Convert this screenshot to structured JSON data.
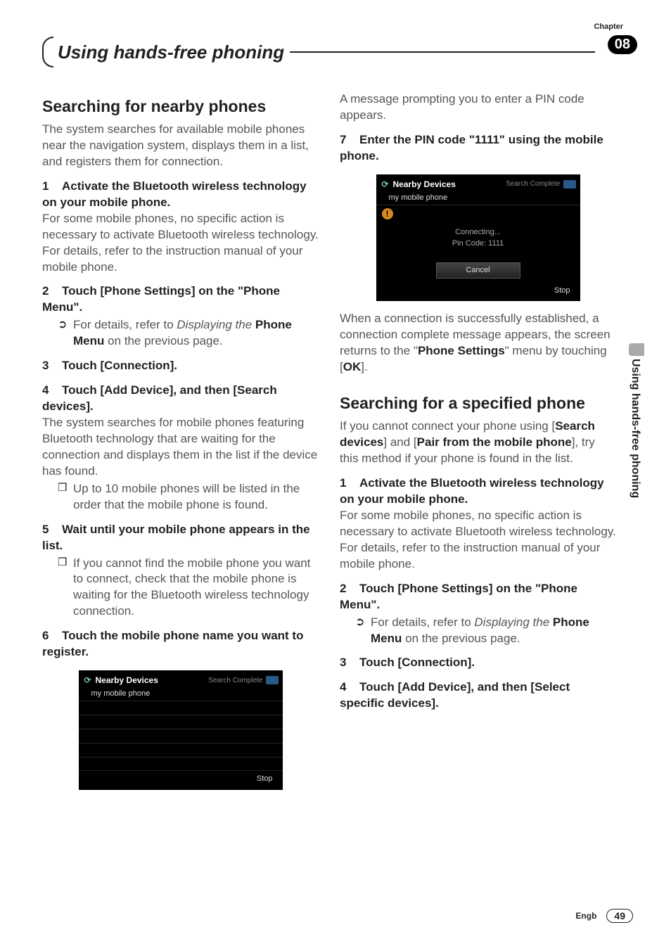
{
  "header": {
    "chapterLabel": "Chapter",
    "chapterNum": "08",
    "title": "Using hands-free phoning"
  },
  "sideTab": "Using hands-free phoning",
  "left": {
    "h1": "Searching for nearby phones",
    "intro": "The system searches for available mobile phones near the navigation system, displays them in a list, and registers them for connection.",
    "s1": {
      "num": "1",
      "title": "Activate the Bluetooth wireless technology on your mobile phone.",
      "body": "For some mobile phones, no specific action is necessary to activate Bluetooth wireless technology. For details, refer to the instruction manual of your mobile phone."
    },
    "s2": {
      "num": "2",
      "title": "Touch [Phone Settings] on the \"Phone Menu\".",
      "sub_pre": "For details, refer to ",
      "sub_italic": "Displaying the ",
      "sub_bold": "Phone Menu",
      "sub_post": " on the previous page."
    },
    "s3": {
      "num": "3",
      "title": "Touch [Connection]."
    },
    "s4": {
      "num": "4",
      "title": "Touch [Add Device], and then [Search devices].",
      "body": "The system searches for mobile phones featuring Bluetooth technology that are waiting for the connection and displays them in the list if the device has found.",
      "sub": "Up to 10 mobile phones will be listed in the order that the mobile phone is found."
    },
    "s5": {
      "num": "5",
      "title": "Wait until your mobile phone appears in the list.",
      "sub": "If you cannot find the mobile phone you want to connect, check that the mobile phone is waiting for the Bluetooth wireless technology connection."
    },
    "s6": {
      "num": "6",
      "title": "Touch the mobile phone name you want to register."
    },
    "ss1": {
      "title": "Nearby Devices",
      "status": "Search Complete",
      "row": "my mobile phone",
      "stop": "Stop"
    }
  },
  "right": {
    "p1a": "A message prompting you to enter a PIN code appears.",
    "s7": {
      "num": "7",
      "title": "Enter the PIN code \"1111\" using the mobile phone."
    },
    "ss2": {
      "title": "Nearby Devices",
      "status": "Search Complete",
      "row": "my mobile phone",
      "line1": "Connecting...",
      "line2": "Pin Code: 1111",
      "cancel": "Cancel",
      "stop": "Stop"
    },
    "p2": {
      "pre": "When a connection is successfully established, a connection complete message appears, the screen returns to the \"",
      "bold1": "Phone Settings",
      "mid": "\" menu by touching [",
      "bold2": "OK",
      "post": "]."
    },
    "h2": "Searching for a specified phone",
    "intro2": {
      "pre": "If you cannot connect your phone using [",
      "b1": "Search devices",
      "mid1": "] and [",
      "b2": "Pair from the mobile phone",
      "post": "], try this method if your phone is found in the list."
    },
    "r1": {
      "num": "1",
      "title": "Activate the Bluetooth wireless technology on your mobile phone.",
      "body": "For some mobile phones, no specific action is necessary to activate Bluetooth wireless technology. For details, refer to the instruction manual of your mobile phone."
    },
    "r2": {
      "num": "2",
      "title": "Touch [Phone Settings] on the \"Phone Menu\".",
      "sub_pre": "For details, refer to ",
      "sub_italic": "Displaying the ",
      "sub_bold": "Phone Menu",
      "sub_post": " on the previous page."
    },
    "r3": {
      "num": "3",
      "title": "Touch [Connection]."
    },
    "r4": {
      "num": "4",
      "title": "Touch [Add Device], and then [Select specific devices]."
    }
  },
  "footer": {
    "lang": "Engb",
    "page": "49"
  }
}
